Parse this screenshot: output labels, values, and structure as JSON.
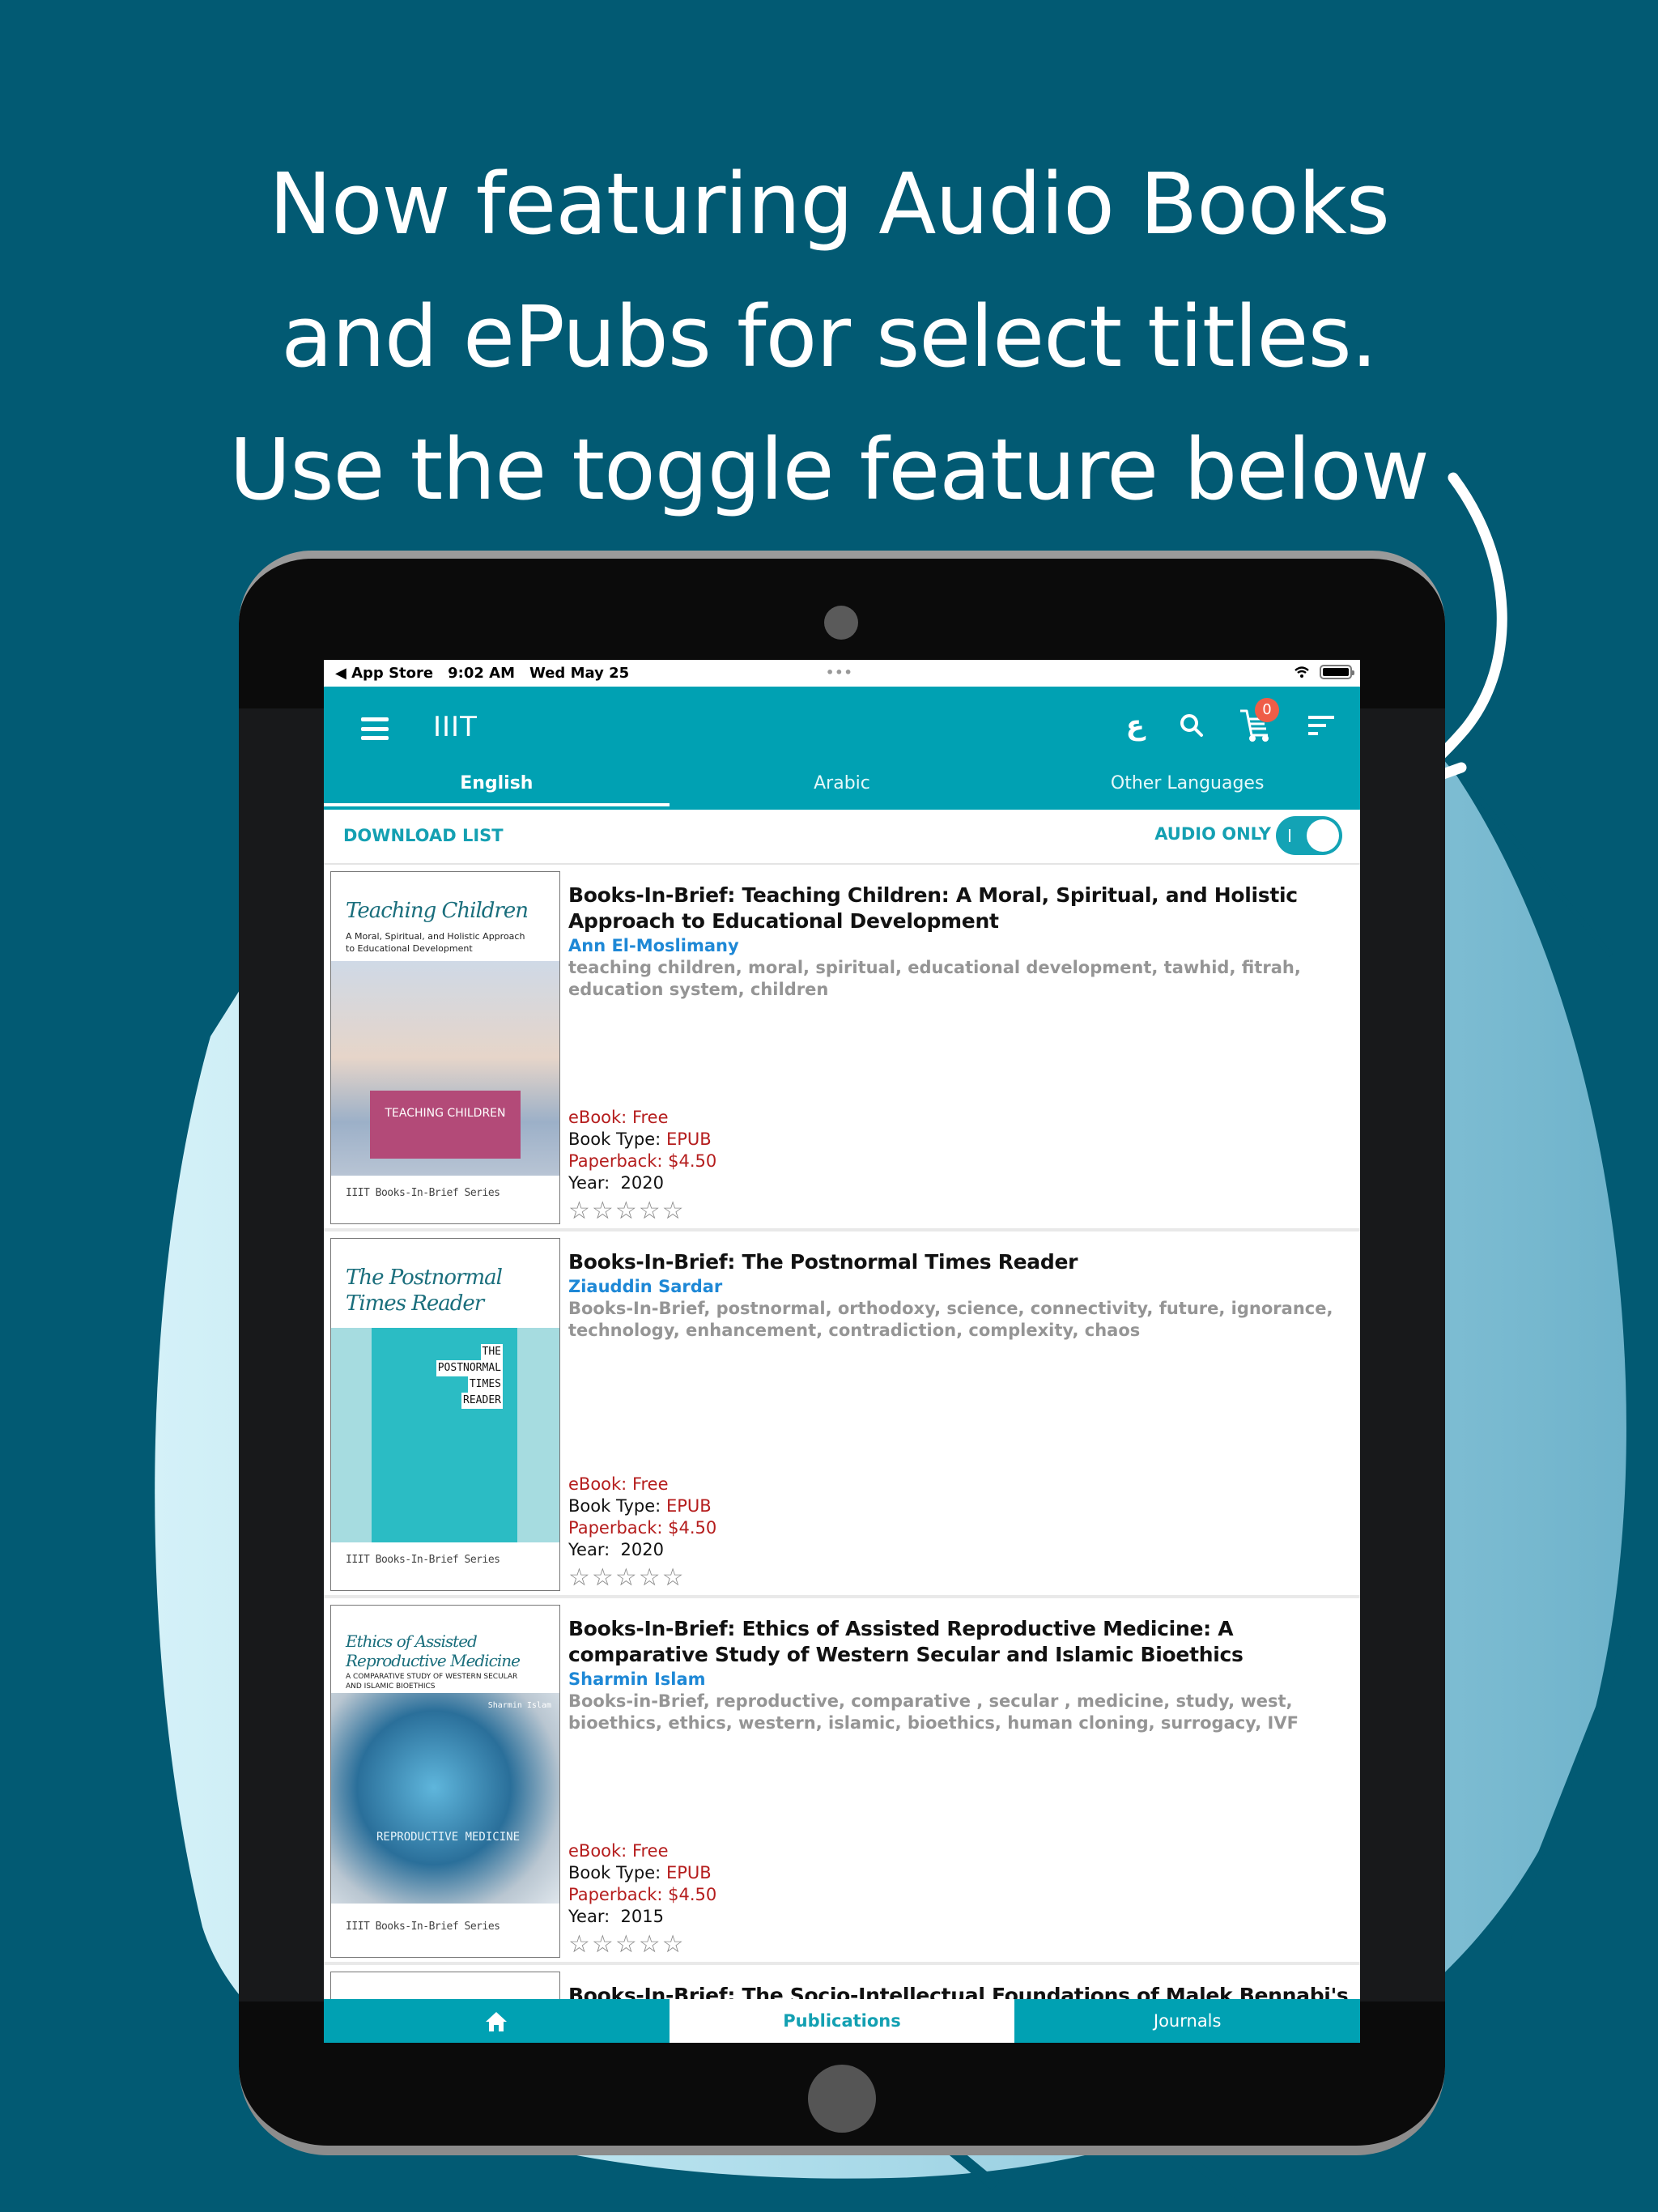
{
  "headline": {
    "lines": [
      "Now featuring Audio Books",
      "and ePubs for select titles.",
      "Use the toggle feature below"
    ]
  },
  "colors": {
    "background": "#025a73",
    "accent": "#00a1b3",
    "author": "#1e88d6",
    "price": "#b51d1d",
    "badge": "#ef5d47"
  },
  "status_bar": {
    "back_label": "◀ App Store",
    "time": "9:02 AM",
    "date": "Wed May 25",
    "dots": "•••"
  },
  "app_bar": {
    "title": "IIIT",
    "language_icon_glyph": "ع",
    "cart_count": "0",
    "icons": [
      "menu-icon",
      "language-icon",
      "search-icon",
      "cart-icon",
      "sort-filter-icon"
    ]
  },
  "tabs": [
    {
      "label": "English",
      "active": true
    },
    {
      "label": "Arabic",
      "active": false
    },
    {
      "label": "Other Languages",
      "active": false
    }
  ],
  "actions": {
    "download_list": "DOWNLOAD LIST",
    "audio_only_label": "AUDIO ONLY",
    "audio_only_on": true
  },
  "books": [
    {
      "title": "Books-In-Brief: Teaching Children: A Moral, Spiritual, and Holistic Approach to Educational Development",
      "author": "Ann El-Moslimany",
      "tags": "teaching children, moral, spiritual, educational development, tawhid, fitrah, education system, children",
      "ebook_label": "eBook:",
      "ebook_value": "Free",
      "type_label": "Book Type:",
      "type_value": "EPUB",
      "paperback": "Paperback: $4.50",
      "year_label": "Year:",
      "year": "2020",
      "rating": 0,
      "cover_title": "Teaching Children",
      "cover_subtitle": "A Moral, Spiritual, and Holistic Approach to Educational Development",
      "cover_band": "TEACHING CHILDREN",
      "cover_series": "IIIT Books-In-Brief Series"
    },
    {
      "title": "Books-In-Brief: The Postnormal Times Reader",
      "author": "Ziauddin Sardar",
      "tags": "Books-In-Brief, postnormal, orthodoxy, science, connectivity, future, ignorance, technology, enhancement, contradiction, complexity, chaos",
      "ebook_label": "eBook:",
      "ebook_value": "Free",
      "type_label": "Book Type:",
      "type_value": "EPUB",
      "paperback": "Paperback: $4.50",
      "year_label": "Year:",
      "year": "2020",
      "rating": 0,
      "cover_title": "The Postnormal Times Reader",
      "cover_words": [
        "THE",
        "POSTNORMAL",
        "TIMES",
        "READER"
      ],
      "cover_series": "IIIT Books-In-Brief Series"
    },
    {
      "title": "Books-In-Brief: Ethics of Assisted Reproductive Medicine: A comparative Study of Western Secular and Islamic Bioethics",
      "author": "Sharmin Islam",
      "tags": "Books-in-Brief, reproductive, comparative , secular , medicine, study, west, bioethics, ethics, western, islamic, bioethics, human cloning, surrogacy, IVF",
      "ebook_label": "eBook:",
      "ebook_value": "Free",
      "type_label": "Book Type:",
      "type_value": "EPUB",
      "paperback": "Paperback: $4.50",
      "year_label": "Year:",
      "year": "2015",
      "rating": 0,
      "cover_title": "Ethics of Assisted Reproductive Medicine",
      "cover_subtitle": "A COMPARATIVE STUDY OF WESTERN SECULAR AND ISLAMIC BIOETHICS",
      "cover_band": "REPRODUCTIVE MEDICINE",
      "cover_author": "Sharmin Islam",
      "cover_series": "IIIT Books-In-Brief Series"
    },
    {
      "title": "Books-In-Brief: The Socio-Intellectual Foundations of Malek Bennabi's"
    }
  ],
  "bottom_nav": [
    {
      "label": "",
      "icon": "home-icon",
      "active": false
    },
    {
      "label": "Publications",
      "active": true
    },
    {
      "label": "Journals",
      "active": false
    }
  ]
}
